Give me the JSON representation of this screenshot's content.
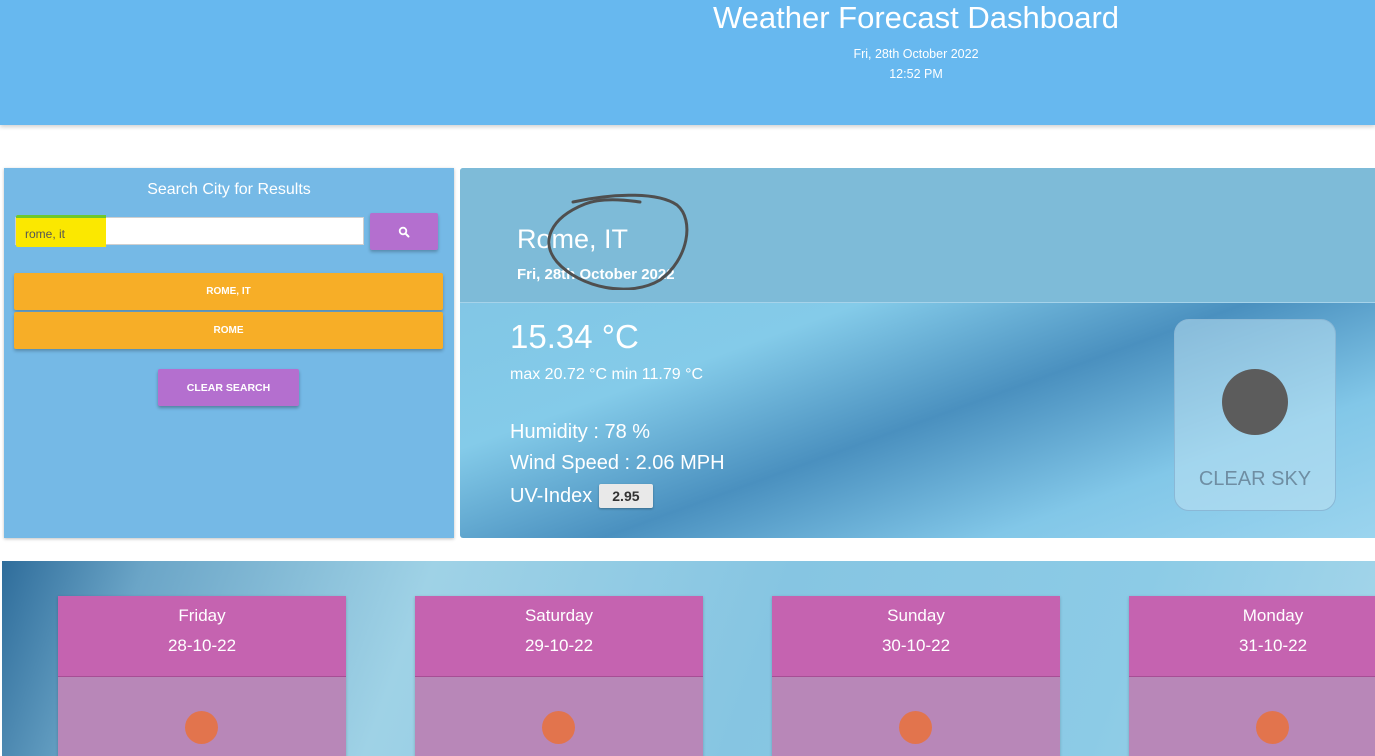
{
  "header": {
    "title": "Weather Forecast Dashboard",
    "date": "Fri, 28th October 2022",
    "time": "12:52 PM",
    "background": "#67b8ef"
  },
  "search": {
    "heading": "Search City for Results",
    "input_value": "rome, it",
    "search_icon": "search-icon",
    "history": [
      "ROME, IT",
      "ROME"
    ],
    "clear_label": "CLEAR SEARCH"
  },
  "current": {
    "city": "Rome, IT",
    "date": "Fri, 28th October 2022",
    "temp": "15.34 °C",
    "maxmin": "max 20.72 °C min 11.79 °C",
    "humidity": "Humidity : 78 %",
    "wind": "Wind Speed : 2.06 MPH",
    "uv_label": "UV-Index",
    "uv_value": "2.95",
    "description": "CLEAR SKY",
    "icon": "dark-sun-icon"
  },
  "forecast": [
    {
      "day": "Friday",
      "date": "28-10-22",
      "icon": "sun-icon"
    },
    {
      "day": "Saturday",
      "date": "29-10-22",
      "icon": "sun-icon"
    },
    {
      "day": "Sunday",
      "date": "30-10-22",
      "icon": "sun-icon"
    },
    {
      "day": "Monday",
      "date": "31-10-22",
      "icon": "sun-icon"
    }
  ],
  "colors": {
    "accent_purple": "#b46fcf",
    "history_orange": "#f7ae27",
    "card_header": "#c563b0",
    "sun_orange": "#e2744d"
  }
}
